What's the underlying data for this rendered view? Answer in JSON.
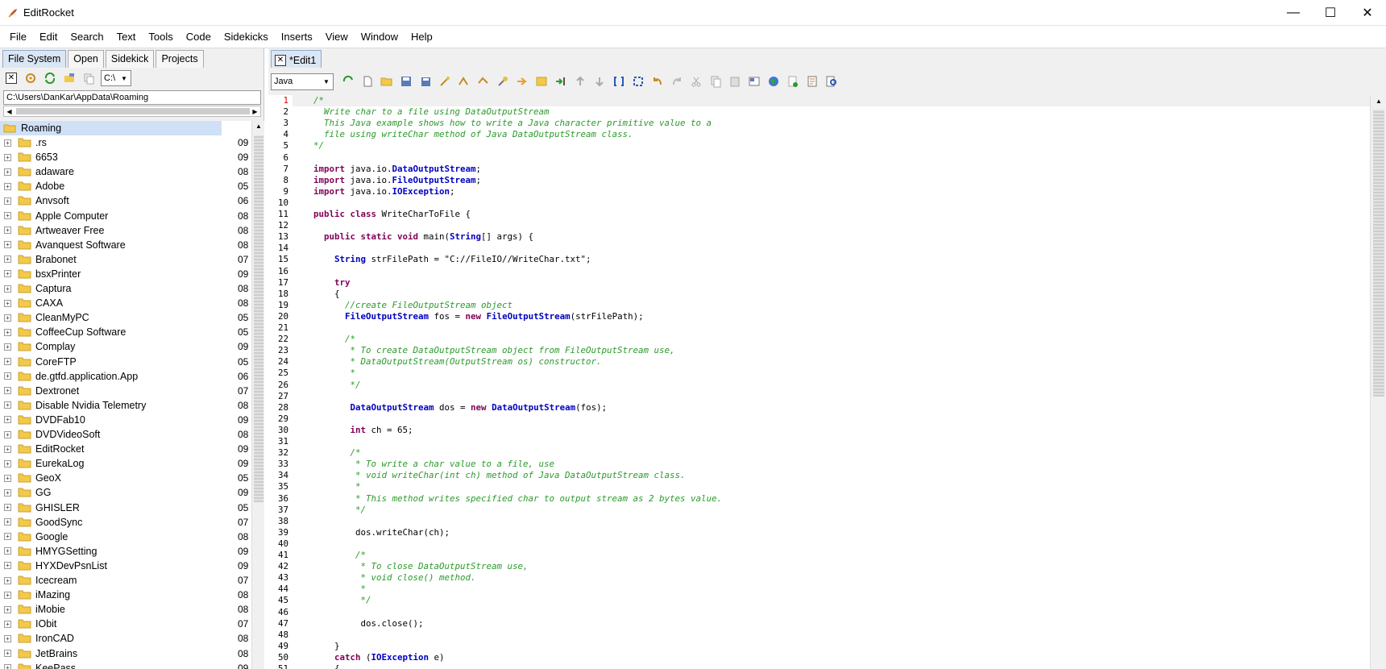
{
  "window": {
    "title": "EditRocket",
    "minimize": "—",
    "maximize": "☐",
    "close": "✕"
  },
  "menu": [
    "File",
    "Edit",
    "Search",
    "Text",
    "Tools",
    "Code",
    "Sidekicks",
    "Inserts",
    "View",
    "Window",
    "Help"
  ],
  "left": {
    "tabs": [
      "File System",
      "Open",
      "Sidekick",
      "Projects"
    ],
    "drive": "C:\\",
    "path": "C:\\Users\\DanKar\\AppData\\Roaming",
    "root": "Roaming",
    "items": [
      {
        "name": ".rs",
        "date": "09"
      },
      {
        "name": "6653",
        "date": "09"
      },
      {
        "name": "adaware",
        "date": "08"
      },
      {
        "name": "Adobe",
        "date": "05"
      },
      {
        "name": "Anvsoft",
        "date": "06"
      },
      {
        "name": "Apple Computer",
        "date": "08"
      },
      {
        "name": "Artweaver Free",
        "date": "08"
      },
      {
        "name": "Avanquest Software",
        "date": "08"
      },
      {
        "name": "Brabonet",
        "date": "07"
      },
      {
        "name": "bsxPrinter",
        "date": "09"
      },
      {
        "name": "Captura",
        "date": "08"
      },
      {
        "name": "CAXA",
        "date": "08"
      },
      {
        "name": "CleanMyPC",
        "date": "05"
      },
      {
        "name": "CoffeeCup Software",
        "date": "05"
      },
      {
        "name": "Complay",
        "date": "09"
      },
      {
        "name": "CoreFTP",
        "date": "05"
      },
      {
        "name": "de.gtfd.application.App",
        "date": "06"
      },
      {
        "name": "Dextronet",
        "date": "07"
      },
      {
        "name": "Disable Nvidia Telemetry",
        "date": "08"
      },
      {
        "name": "DVDFab10",
        "date": "09"
      },
      {
        "name": "DVDVideoSoft",
        "date": "08"
      },
      {
        "name": "EditRocket",
        "date": "09"
      },
      {
        "name": "EurekaLog",
        "date": "09"
      },
      {
        "name": "GeoX",
        "date": "05"
      },
      {
        "name": "GG",
        "date": "09"
      },
      {
        "name": "GHISLER",
        "date": "05"
      },
      {
        "name": "GoodSync",
        "date": "07"
      },
      {
        "name": "Google",
        "date": "08"
      },
      {
        "name": "HMYGSetting",
        "date": "09"
      },
      {
        "name": "HYXDevPsnList",
        "date": "09"
      },
      {
        "name": "Icecream",
        "date": "07"
      },
      {
        "name": "iMazing",
        "date": "08"
      },
      {
        "name": "iMobie",
        "date": "08"
      },
      {
        "name": "IObit",
        "date": "07"
      },
      {
        "name": "IronCAD",
        "date": "08"
      },
      {
        "name": "JetBrains",
        "date": "08"
      },
      {
        "name": "KeePass",
        "date": "09"
      }
    ]
  },
  "editor": {
    "tab": "*Edit1",
    "language": "Java",
    "lines": [
      {
        "n": "1",
        "parts": [
          [
            "c-com",
            "    /*"
          ]
        ]
      },
      {
        "n": "2",
        "parts": [
          [
            "c-com",
            "      Write char to a file using DataOutputStream"
          ]
        ]
      },
      {
        "n": "3",
        "parts": [
          [
            "c-com",
            "      This Java example shows how to write a Java character primitive value to a"
          ]
        ]
      },
      {
        "n": "4",
        "parts": [
          [
            "c-com",
            "      file using writeChar method of Java DataOutputStream class."
          ]
        ]
      },
      {
        "n": "5",
        "parts": [
          [
            "c-com",
            "    */"
          ]
        ]
      },
      {
        "n": "6",
        "parts": [
          [
            "c-n",
            ""
          ]
        ]
      },
      {
        "n": "7",
        "parts": [
          [
            "c-kw",
            "    import"
          ],
          [
            "c-n",
            " java.io."
          ],
          [
            "c-type",
            "DataOutputStream"
          ],
          [
            "c-n",
            ";"
          ]
        ]
      },
      {
        "n": "8",
        "parts": [
          [
            "c-kw",
            "    import"
          ],
          [
            "c-n",
            " java.io."
          ],
          [
            "c-type",
            "FileOutputStream"
          ],
          [
            "c-n",
            ";"
          ]
        ]
      },
      {
        "n": "9",
        "parts": [
          [
            "c-kw",
            "    import"
          ],
          [
            "c-n",
            " java.io."
          ],
          [
            "c-type",
            "IOException"
          ],
          [
            "c-n",
            ";"
          ]
        ]
      },
      {
        "n": "10",
        "parts": [
          [
            "c-n",
            ""
          ]
        ]
      },
      {
        "n": "11",
        "parts": [
          [
            "c-kw",
            "    public class"
          ],
          [
            "c-n",
            " WriteCharToFile {"
          ]
        ]
      },
      {
        "n": "12",
        "parts": [
          [
            "c-n",
            ""
          ]
        ]
      },
      {
        "n": "13",
        "parts": [
          [
            "c-kw",
            "      public static void"
          ],
          [
            "c-n",
            " main("
          ],
          [
            "c-type",
            "String"
          ],
          [
            "c-n",
            "[] args) {"
          ]
        ]
      },
      {
        "n": "14",
        "parts": [
          [
            "c-n",
            ""
          ]
        ]
      },
      {
        "n": "15",
        "parts": [
          [
            "c-type",
            "        String"
          ],
          [
            "c-n",
            " strFilePath = "
          ],
          [
            "c-str",
            "\"C://FileIO//WriteChar.txt\""
          ],
          [
            "c-n",
            ";"
          ]
        ]
      },
      {
        "n": "16",
        "parts": [
          [
            "c-n",
            ""
          ]
        ]
      },
      {
        "n": "17",
        "parts": [
          [
            "c-kw",
            "        try"
          ]
        ]
      },
      {
        "n": "18",
        "parts": [
          [
            "c-n",
            "        {"
          ]
        ]
      },
      {
        "n": "19",
        "parts": [
          [
            "c-com",
            "          //create FileOutputStream object"
          ]
        ]
      },
      {
        "n": "20",
        "parts": [
          [
            "c-type",
            "          FileOutputStream"
          ],
          [
            "c-n",
            " fos = "
          ],
          [
            "c-kw",
            "new"
          ],
          [
            "c-n",
            " "
          ],
          [
            "c-type",
            "FileOutputStream"
          ],
          [
            "c-n",
            "(strFilePath);"
          ]
        ]
      },
      {
        "n": "21",
        "parts": [
          [
            "c-n",
            ""
          ]
        ]
      },
      {
        "n": "22",
        "parts": [
          [
            "c-com",
            "          /*"
          ]
        ]
      },
      {
        "n": "23",
        "parts": [
          [
            "c-com",
            "           * To create DataOutputStream object from FileOutputStream use,"
          ]
        ]
      },
      {
        "n": "24",
        "parts": [
          [
            "c-com",
            "           * DataOutputStream(OutputStream os) constructor."
          ]
        ]
      },
      {
        "n": "25",
        "parts": [
          [
            "c-com",
            "           *"
          ]
        ]
      },
      {
        "n": "26",
        "parts": [
          [
            "c-com",
            "           */"
          ]
        ]
      },
      {
        "n": "27",
        "parts": [
          [
            "c-n",
            ""
          ]
        ]
      },
      {
        "n": "28",
        "parts": [
          [
            "c-type",
            "           DataOutputStream"
          ],
          [
            "c-n",
            " dos = "
          ],
          [
            "c-kw",
            "new"
          ],
          [
            "c-n",
            " "
          ],
          [
            "c-type",
            "DataOutputStream"
          ],
          [
            "c-n",
            "(fos);"
          ]
        ]
      },
      {
        "n": "29",
        "parts": [
          [
            "c-n",
            ""
          ]
        ]
      },
      {
        "n": "30",
        "parts": [
          [
            "c-kw",
            "           int"
          ],
          [
            "c-n",
            " ch = 65;"
          ]
        ]
      },
      {
        "n": "31",
        "parts": [
          [
            "c-n",
            ""
          ]
        ]
      },
      {
        "n": "32",
        "parts": [
          [
            "c-com",
            "           /*"
          ]
        ]
      },
      {
        "n": "33",
        "parts": [
          [
            "c-com",
            "            * To write a char value to a file, use"
          ]
        ]
      },
      {
        "n": "34",
        "parts": [
          [
            "c-com",
            "            * void writeChar(int ch) method of Java DataOutputStream class."
          ]
        ]
      },
      {
        "n": "35",
        "parts": [
          [
            "c-com",
            "            *"
          ]
        ]
      },
      {
        "n": "36",
        "parts": [
          [
            "c-com",
            "            * This method writes specified char to output stream as 2 bytes value."
          ]
        ]
      },
      {
        "n": "37",
        "parts": [
          [
            "c-com",
            "            */"
          ]
        ]
      },
      {
        "n": "38",
        "parts": [
          [
            "c-n",
            ""
          ]
        ]
      },
      {
        "n": "39",
        "parts": [
          [
            "c-n",
            "            dos.writeChar(ch);"
          ]
        ]
      },
      {
        "n": "40",
        "parts": [
          [
            "c-n",
            ""
          ]
        ]
      },
      {
        "n": "41",
        "parts": [
          [
            "c-com",
            "            /*"
          ]
        ]
      },
      {
        "n": "42",
        "parts": [
          [
            "c-com",
            "             * To close DataOutputStream use,"
          ]
        ]
      },
      {
        "n": "43",
        "parts": [
          [
            "c-com",
            "             * void close() method."
          ]
        ]
      },
      {
        "n": "44",
        "parts": [
          [
            "c-com",
            "             *"
          ]
        ]
      },
      {
        "n": "45",
        "parts": [
          [
            "c-com",
            "             */"
          ]
        ]
      },
      {
        "n": "46",
        "parts": [
          [
            "c-n",
            ""
          ]
        ]
      },
      {
        "n": "47",
        "parts": [
          [
            "c-n",
            "             dos.close();"
          ]
        ]
      },
      {
        "n": "48",
        "parts": [
          [
            "c-n",
            ""
          ]
        ]
      },
      {
        "n": "49",
        "parts": [
          [
            "c-n",
            "        }"
          ]
        ]
      },
      {
        "n": "50",
        "parts": [
          [
            "c-kw",
            "        catch"
          ],
          [
            "c-n",
            " ("
          ],
          [
            "c-type",
            "IOException"
          ],
          [
            "c-n",
            " e)"
          ]
        ]
      },
      {
        "n": "51",
        "parts": [
          [
            "c-n",
            "        {"
          ]
        ]
      }
    ]
  },
  "icons": {
    "folder_color": "#f3c94a",
    "accent": "#dbe6f4"
  }
}
